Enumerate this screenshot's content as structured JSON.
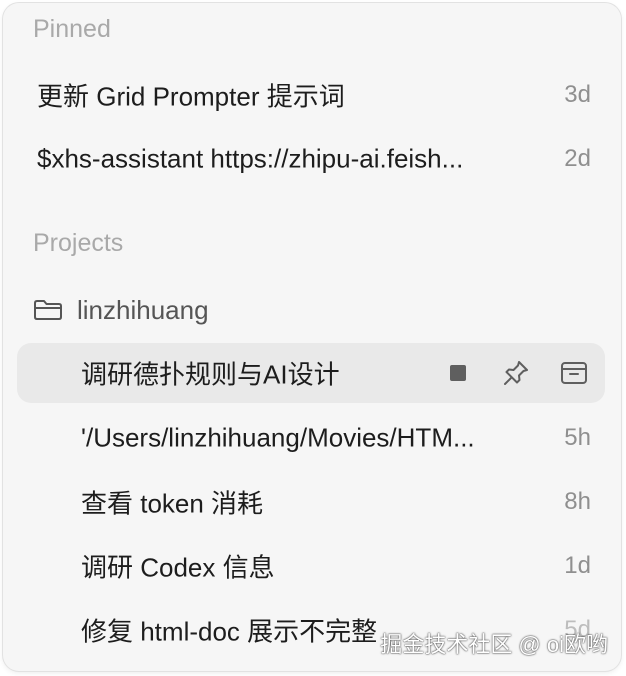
{
  "pinned": {
    "title": "Pinned",
    "items": [
      {
        "title": "更新 Grid Prompter 提示词",
        "time": "3d"
      },
      {
        "title": "$xhs-assistant https://zhipu-ai.feish...",
        "time": "2d"
      }
    ]
  },
  "projects": {
    "title": "Projects",
    "folder": {
      "name": "linzhihuang",
      "icon": "folder-icon"
    },
    "items": [
      {
        "title": "调研德扑规则与AI设计",
        "time": ""
      },
      {
        "title": "'/Users/linzhihuang/Movies/HTM...",
        "time": "5h"
      },
      {
        "title": "查看 token 消耗",
        "time": "8h"
      },
      {
        "title": "调研 Codex 信息",
        "time": "1d"
      },
      {
        "title": "修复 html-doc 展示不完整",
        "time": "5d"
      }
    ],
    "active_actions": [
      "stop-icon",
      "pin-icon",
      "archive-icon"
    ]
  },
  "watermark": "掘金技术社区 @ oi欧哟"
}
